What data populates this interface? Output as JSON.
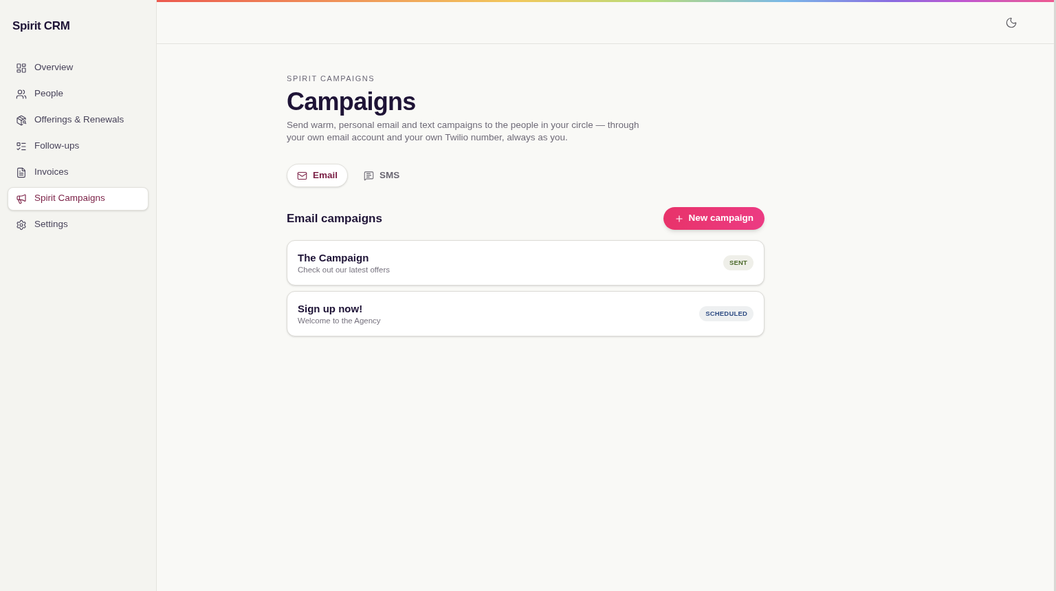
{
  "sidebar": {
    "brand": "Spirit CRM",
    "items": [
      {
        "label": "Overview",
        "selected": false
      },
      {
        "label": "People",
        "selected": false
      },
      {
        "label": "Offerings & Renewals",
        "selected": false
      },
      {
        "label": "Follow-ups",
        "selected": false
      },
      {
        "label": "Invoices",
        "selected": false
      },
      {
        "label": "Spirit Campaigns",
        "selected": true
      },
      {
        "label": "Settings",
        "selected": false
      }
    ]
  },
  "page": {
    "eyebrow": "SPIRIT CAMPAIGNS",
    "title": "Campaigns",
    "description": "Send warm, personal email and text campaigns to the people in your circle — through your own email account and your own Twilio number, always as you."
  },
  "tabs": [
    {
      "label": "Email",
      "selected": true
    },
    {
      "label": "SMS",
      "selected": false
    }
  ],
  "section": {
    "title": "Email campaigns",
    "action": "New campaign"
  },
  "campaigns": [
    {
      "name": "The Campaign",
      "subject": "Check out our latest offers",
      "status": "SENT",
      "kind": "sent"
    },
    {
      "name": "Sign up now!",
      "subject": "Welcome to the Agency",
      "status": "SCHEDULED",
      "kind": "scheduled"
    }
  ]
}
